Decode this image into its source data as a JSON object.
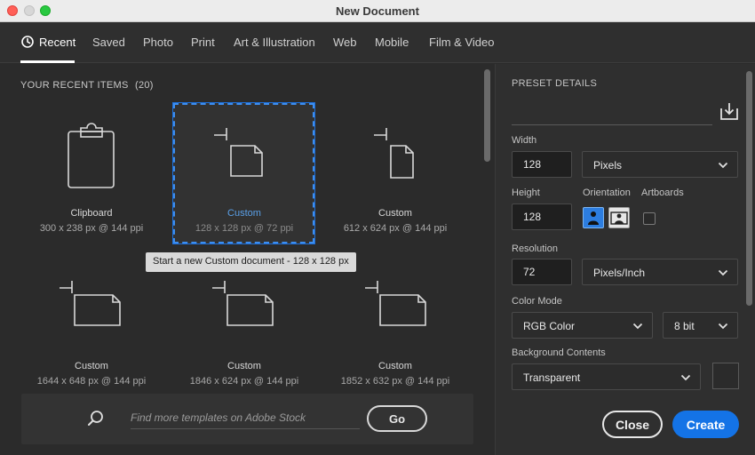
{
  "window": {
    "title": "New Document"
  },
  "tabs": [
    {
      "label": "Recent"
    },
    {
      "label": "Saved"
    },
    {
      "label": "Photo"
    },
    {
      "label": "Print"
    },
    {
      "label": "Art & Illustration"
    },
    {
      "label": "Web"
    },
    {
      "label": "Mobile"
    },
    {
      "label": "Film & Video"
    }
  ],
  "recent": {
    "header": "YOUR RECENT ITEMS",
    "count": "(20)",
    "items": [
      {
        "name": "Clipboard",
        "size": "300 x 238 px @ 144 ppi",
        "icon": "clipboard-icon"
      },
      {
        "name": "Custom",
        "size": "128 x 128 px @ 72 ppi",
        "icon": "custom-document-icon"
      },
      {
        "name": "Custom",
        "size": "612 x 624 px @ 144 ppi",
        "icon": "custom-document-icon"
      },
      {
        "name": "Custom",
        "size": "1644 x 648 px @ 144 ppi",
        "icon": "custom-document-icon"
      },
      {
        "name": "Custom",
        "size": "1846 x 624 px @ 144 ppi",
        "icon": "custom-document-icon"
      },
      {
        "name": "Custom",
        "size": "1852 x 632 px @ 144 ppi",
        "icon": "custom-document-icon"
      }
    ],
    "tooltip": "Start a new Custom document - 128 x 128 px"
  },
  "search": {
    "placeholder": "Find more templates on Adobe Stock",
    "go_label": "Go"
  },
  "preset": {
    "header": "PRESET DETAILS",
    "width_label": "Width",
    "width_value": "128",
    "width_unit": "Pixels",
    "height_label": "Height",
    "height_value": "128",
    "orientation_label": "Orientation",
    "artboards_label": "Artboards",
    "resolution_label": "Resolution",
    "resolution_value": "72",
    "resolution_unit": "Pixels/Inch",
    "color_mode_label": "Color Mode",
    "color_mode_value": "RGB Color",
    "bit_depth": "8 bit",
    "background_label": "Background Contents",
    "background_value": "Transparent"
  },
  "actions": {
    "close_label": "Close",
    "create_label": "Create"
  },
  "colors": {
    "accent": "#1473e6",
    "selection": "#3d8ef0",
    "bg": "#2b2b2b"
  }
}
